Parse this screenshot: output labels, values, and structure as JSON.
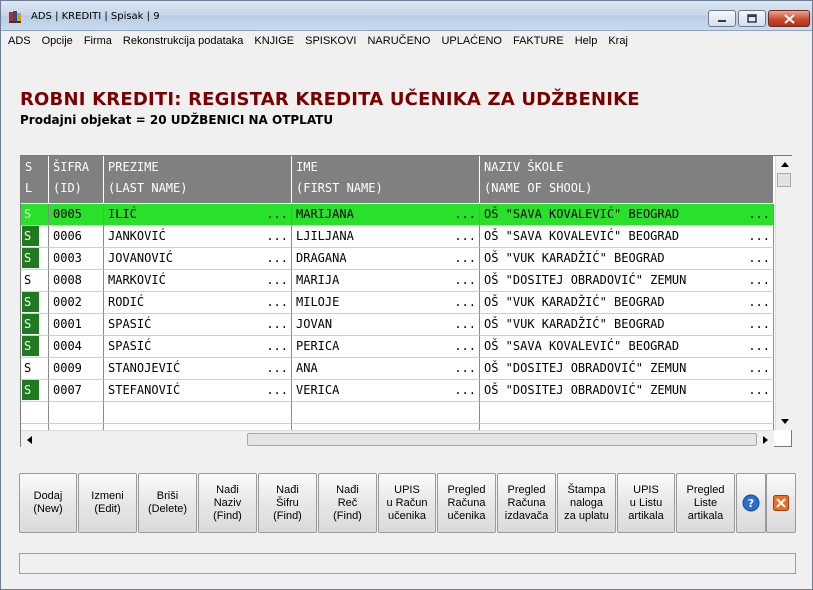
{
  "window": {
    "title": "ADS | KREDITI | Spisak | 9"
  },
  "menu": [
    "ADS",
    "Opcije",
    "Firma",
    "Rekonstrukcija podataka",
    "KNJIGE",
    "SPISKOVI",
    "NARUČENO",
    "UPLAĆENO",
    "FAKTURE",
    "Help",
    "Kraj"
  ],
  "header": {
    "title": "ROBNI KREDITI: REGISTAR KREDITA UČENIKA ZA UDŽBENIKE",
    "subtitle": "Prodajni objekat = 20 UDŽBENICI NA OTPLATU"
  },
  "grid": {
    "columns": [
      {
        "line1": "S",
        "line2": "L"
      },
      {
        "line1": "ŠIFRA",
        "line2": "(ID)"
      },
      {
        "line1": "PREZIME",
        "line2": "(LAST NAME)"
      },
      {
        "line1": "IME",
        "line2": "(FIRST NAME)"
      },
      {
        "line1": "NAZIV ŠKOLE",
        "line2": "(NAME OF SHOOL)"
      }
    ],
    "ellipsis": "...",
    "selected_index": 0,
    "rows": [
      {
        "s": "S",
        "s_marked": true,
        "id": "0005",
        "last": "ILIĆ",
        "first": "MARIJANA",
        "school": "OŠ \"SAVA KOVALEVIĆ\" BEOGRAD"
      },
      {
        "s": "S",
        "s_marked": true,
        "id": "0006",
        "last": "JANKOVIĆ",
        "first": "LJILJANA",
        "school": "OŠ \"SAVA KOVALEVIĆ\" BEOGRAD"
      },
      {
        "s": "S",
        "s_marked": true,
        "id": "0003",
        "last": "JOVANOVIĆ",
        "first": "DRAGANA",
        "school": "OŠ \"VUK KARADŽIĆ\" BEOGRAD"
      },
      {
        "s": "S",
        "s_marked": false,
        "id": "0008",
        "last": "MARKOVIĆ",
        "first": "MARIJA",
        "school": "OŠ \"DOSITEJ OBRADOVIĆ\" ZEMUN"
      },
      {
        "s": "S",
        "s_marked": true,
        "id": "0002",
        "last": "RODIĆ",
        "first": "MILOJE",
        "school": "OŠ \"VUK KARADŽIĆ\" BEOGRAD"
      },
      {
        "s": "S",
        "s_marked": true,
        "id": "0001",
        "last": "SPASIĆ",
        "first": "JOVAN",
        "school": "OŠ \"VUK KARADŽIĆ\" BEOGRAD"
      },
      {
        "s": "S",
        "s_marked": true,
        "id": "0004",
        "last": "SPASIĆ",
        "first": "PERICA",
        "school": "OŠ \"SAVA KOVALEVIĆ\" BEOGRAD"
      },
      {
        "s": "S",
        "s_marked": false,
        "id": "0009",
        "last": "STANOJEVIĆ",
        "first": "ANA",
        "school": "OŠ \"DOSITEJ OBRADOVIĆ\" ZEMUN"
      },
      {
        "s": "S",
        "s_marked": true,
        "id": "0007",
        "last": "STEFANOVIĆ",
        "first": "VERICA",
        "school": "OŠ \"DOSITEJ OBRADOVIĆ\" ZEMUN"
      }
    ]
  },
  "toolbar": {
    "buttons": [
      {
        "name": "dodaj-button",
        "label": "Dodaj\n(New)"
      },
      {
        "name": "izmeni-button",
        "label": "Izmeni\n(Edit)"
      },
      {
        "name": "brisi-button",
        "label": "Briši\n(Delete)"
      },
      {
        "name": "nadji-naziv-button",
        "label": "Nađi\nNaziv\n(Find)"
      },
      {
        "name": "nadji-sifru-button",
        "label": "Nađi\nŠifru\n(Find)"
      },
      {
        "name": "nadji-rec-button",
        "label": "Nađi\nReč\n(Find)"
      },
      {
        "name": "upis-racun-button",
        "label": "UPIS\nu Račun\nučenika"
      },
      {
        "name": "pregled-racuna-ucenika-button",
        "label": "Pregled\nRačuna\nučenika"
      },
      {
        "name": "pregled-racuna-izdavaca-button",
        "label": "Pregled\nRačuna\nizdavača"
      },
      {
        "name": "stampa-naloga-button",
        "label": "Štampa\nnaloga\nza uplatu"
      },
      {
        "name": "upis-lista-button",
        "label": "UPIS\nu Listu\nartikala"
      },
      {
        "name": "pregled-liste-button",
        "label": "Pregled\nListe\nartikala"
      }
    ],
    "icons": [
      "help-icon",
      "exit-icon"
    ]
  },
  "colors": {
    "title": "#7a0000",
    "selected_row": "#29e02a",
    "marked_cell": "#1f7a1f",
    "header_bg": "#808080"
  }
}
